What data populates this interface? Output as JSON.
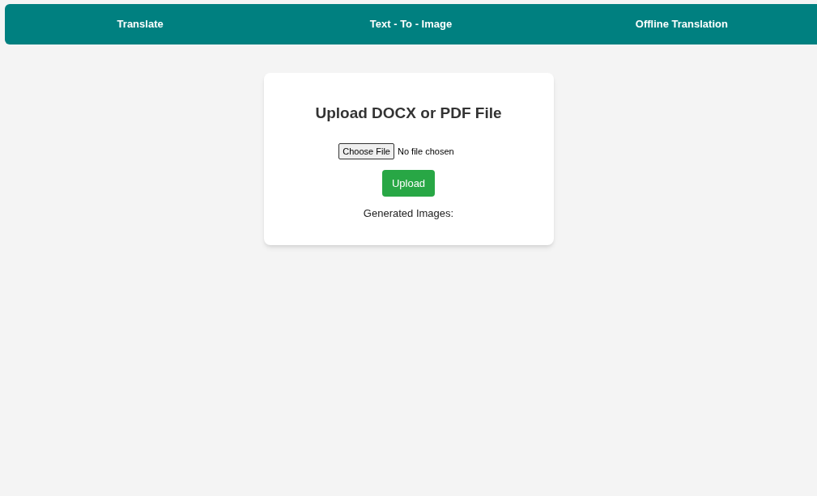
{
  "nav": {
    "links": [
      {
        "label": "Translate"
      },
      {
        "label": "Text - To - Image"
      },
      {
        "label": "Offline Translation"
      }
    ]
  },
  "card": {
    "title": "Upload DOCX or PDF File",
    "file_button": "Choose File",
    "file_status": "No file chosen",
    "upload_button": "Upload",
    "results_label": "Generated Images:"
  }
}
